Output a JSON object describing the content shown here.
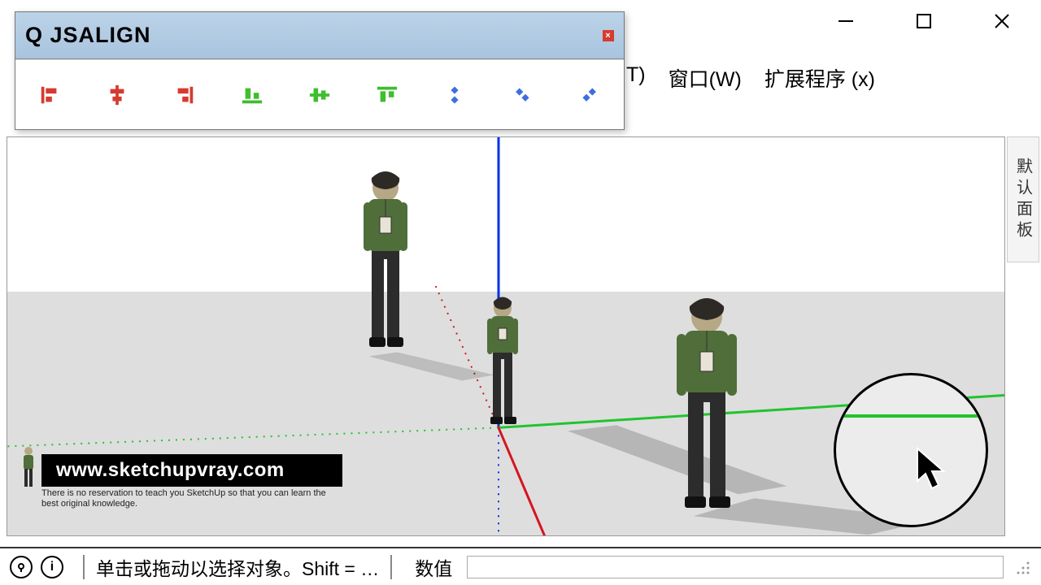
{
  "window": {
    "minimize_icon": "minimize",
    "maximize_icon": "maximize",
    "close_icon": "close"
  },
  "menu": {
    "t_frag": "T)",
    "window": "窗口(W)",
    "ext": "扩展程序 (x)"
  },
  "toolbar": {
    "title": "Q JSALIGN",
    "close": "×",
    "tools": [
      "align-left-red",
      "align-center-h-red",
      "align-right-red",
      "align-bottom-green",
      "align-center-v-green",
      "align-top-green",
      "align-diag-blue-1",
      "align-diag-blue-2",
      "align-diag-blue-3"
    ]
  },
  "side_tab": "默认面板",
  "status": {
    "hint": "单击或拖动以选择对象。Shift = …",
    "vcb_label": "数值",
    "vcb_value": ""
  },
  "watermark": {
    "url": "www.sketchupvray.com",
    "sub": "There is no reservation to teach you SketchUp so that you can learn the best original knowledge."
  }
}
